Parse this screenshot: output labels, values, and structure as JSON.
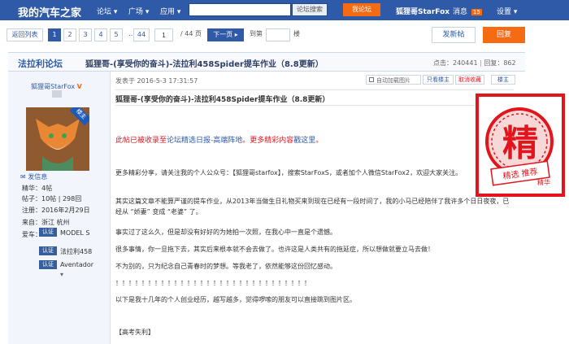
{
  "header": {
    "site_name": "我的汽车之家",
    "nav_forum": "论坛 ▾",
    "nav_square": "广场 ▾",
    "nav_apps": "应用 ▾",
    "search_placeholder": "",
    "search_button": "论坛搜索",
    "hot_button": "我论坛",
    "username": "狐狸哥StarFox",
    "messages_label": "消息",
    "messages_count": "15",
    "settings_label": "设置 ▾"
  },
  "pager": {
    "back": "返回列表",
    "pages": [
      "1",
      "2",
      "3",
      "4",
      "5",
      "...",
      "44"
    ],
    "page_input": "1",
    "total": "/ 44 页",
    "next": "下一页 ▸",
    "jump_label": "到第",
    "jump_suffix": "楼",
    "new_post": "发新帖",
    "reply": "回复"
  },
  "thread": {
    "board": "法拉利论坛",
    "title": "狐狸哥-(享受你的奋斗)-法拉利458Spider提车作业（8.8更新）",
    "views": "点击：240441",
    "replies": "回复：862"
  },
  "author": {
    "name": "狐狸哥StarFox",
    "v": "V",
    "owner_badge": "楼主",
    "send_message": "发信息",
    "essence": "精华：4帖",
    "posts": "帖子：10帖 | 298回",
    "registered": "注册：2016年2月29日",
    "location": "来自：浙江 杭州",
    "cars_label": "爱车：",
    "cert_label": "认证",
    "cars": [
      "MODEL S",
      "法拉利458",
      "Aventador"
    ],
    "more": "▾"
  },
  "post": {
    "time": "发表于 2016-5-3 17:31:57",
    "auto_load": "自动加载图片",
    "only_owner": "只看楼主",
    "cancel_fav": "取消收藏",
    "floor": "楼主",
    "heading": "狐狸哥-(享受你的奋斗)-法拉利458Spider提车作业（8.8更新）",
    "red_notice_prefix": "此帖已被收录至",
    "red_notice_link": "论坛精选日报-高端阵地",
    "red_notice_mid": "。更多精彩内容",
    "red_notice_link2": "戳这里",
    "red_notice_end": "。",
    "p1": "更多精彩分享，请关注我的个人公众号：【狐狸哥starfox】，搜索StarFoxS，或者加个人微信StarFox2，欢迎大家关注。",
    "p2": "其实这篇文章不能算严谨的提车作业，从2013年当做生日礼物买来到现在已经有一段时间了，我的小马已经陪伴了我许多个日日夜夜，已经从 “娇妻” 变成 “老婆” 了。",
    "p3": "事实过了这么久，但是却没有好好的为她拍一次照，在我心中一直是个遗憾。",
    "p4": "很多事情，你一旦拖下去，其实后来根本就不会去做了。也许这是人类共有的拖延症，所以想做就要立马去做！",
    "p5": "不为别的，只为纪念自己青春时的梦想。等我老了，依然能够这份回忆感动。",
    "p6": "！！！！！！！！！！！！！！！！！！！！！！！！！！！！！！",
    "p7": "以下是我十几年的个人创业经历，越写越多，觉得啰嗦的朋友可以直接跳到图片区。",
    "p8": "【高考失利】"
  },
  "stamp": {
    "big_char": "精",
    "small": "精选 推荐",
    "label": "精华"
  }
}
